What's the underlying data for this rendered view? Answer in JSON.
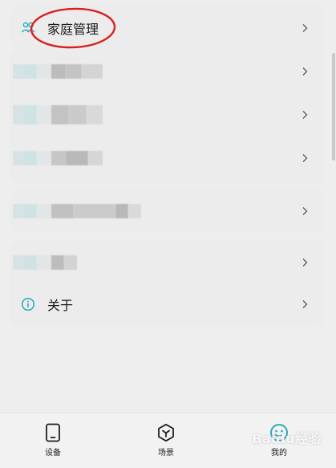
{
  "menu": {
    "family_management_label": "家庭管理",
    "about_label": "关于"
  },
  "bottom_nav": {
    "items": [
      {
        "label": "设备",
        "icon": "tablet-icon"
      },
      {
        "label": "场景",
        "icon": "cube-icon"
      },
      {
        "label": "我的",
        "icon": "smiley-icon",
        "active": true
      }
    ]
  },
  "watermark": "Baidu经验",
  "colors": {
    "accent": "#2fa8b8",
    "annotation": "#d82020",
    "chevron": "#555555"
  }
}
